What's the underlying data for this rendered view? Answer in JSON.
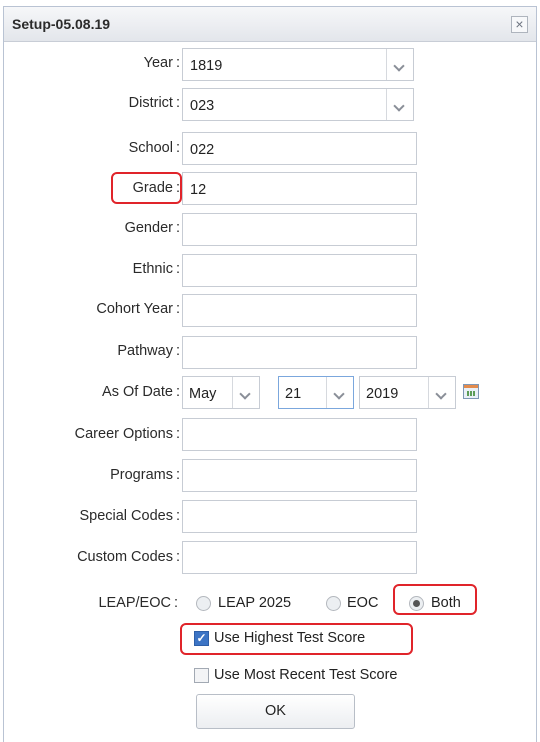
{
  "dialog": {
    "title": "Setup-05.08.19",
    "close_symbol": "×"
  },
  "fields": {
    "year": {
      "label": "Year",
      "value": "1819"
    },
    "district": {
      "label": "District",
      "value": "023"
    },
    "school": {
      "label": "School",
      "value": "022"
    },
    "grade": {
      "label": "Grade",
      "value": "12"
    },
    "gender": {
      "label": "Gender",
      "value": ""
    },
    "ethnic": {
      "label": "Ethnic",
      "value": ""
    },
    "cohort_year": {
      "label": "Cohort Year",
      "value": ""
    },
    "pathway": {
      "label": "Pathway",
      "value": ""
    },
    "as_of_date": {
      "label": "As Of Date",
      "month": "May",
      "day": "21",
      "year": "2019"
    },
    "career_options": {
      "label": "Career Options",
      "value": ""
    },
    "programs": {
      "label": "Programs",
      "value": ""
    },
    "special_codes": {
      "label": "Special Codes",
      "value": ""
    },
    "custom_codes": {
      "label": "Custom Codes",
      "value": ""
    }
  },
  "leap_eoc": {
    "label": "LEAP/EOC",
    "options": [
      "LEAP 2025",
      "EOC",
      "Both"
    ],
    "selected": "Both"
  },
  "checkboxes": {
    "highest": {
      "label": "Use Highest Test Score",
      "checked": true
    },
    "recent": {
      "label": "Use Most Recent Test Score",
      "checked": false
    }
  },
  "ok_label": "OK",
  "highlight_color": "#e0242a",
  "icons": {
    "calendar": "calendar-icon",
    "close": "close-icon"
  }
}
